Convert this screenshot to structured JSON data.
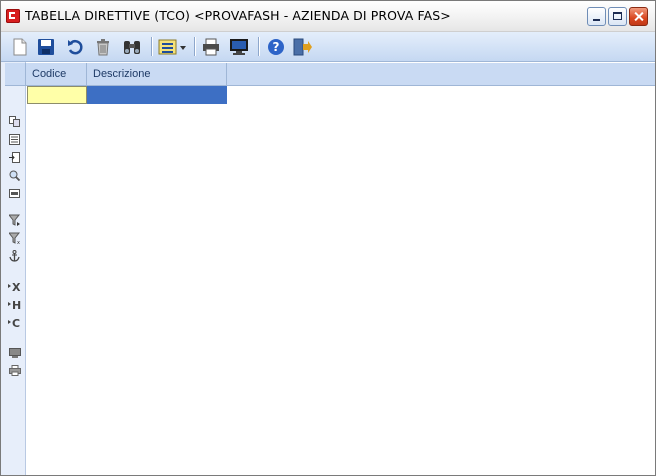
{
  "window": {
    "title": "TABELLA DIRETTIVE (TCO) <PROVAFASH - AZIENDA DI PROVA FAS>"
  },
  "toolbar": {
    "buttons": [
      "new-document-icon",
      "save-icon",
      "undo-icon",
      "delete-icon",
      "find-icon",
      "layout-dropdown-icon",
      "print-icon",
      "display-icon",
      "help-icon",
      "exit-icon"
    ]
  },
  "grid": {
    "columns": [
      {
        "label": "Codice"
      },
      {
        "label": "Descrizione"
      }
    ],
    "rows": [
      {
        "codice": "",
        "descrizione": ""
      }
    ]
  },
  "leftstrip": {
    "icons": [
      "copy-record-icon",
      "list-icon",
      "insert-icon",
      "zoom-icon",
      "card-icon",
      "filter-apply-icon",
      "filter-clear-icon",
      "anchor-icon"
    ],
    "export_labels": [
      "X",
      "H",
      "C"
    ]
  },
  "colors": {
    "toolbar": "#c5d8f2",
    "selected_cell": "#ffffa8",
    "selected_row": "#3d6fc4"
  }
}
